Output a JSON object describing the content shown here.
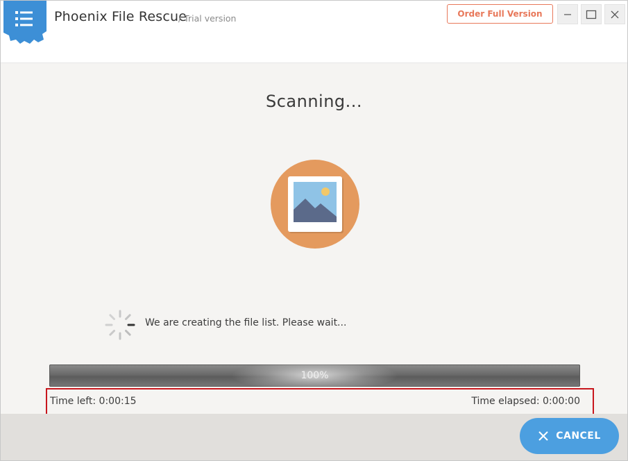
{
  "app": {
    "title": "Phoenix File Rescue",
    "subtitle": "/ Trial version",
    "order_button_label": "Order Full Version"
  },
  "window_controls": {
    "minimize_icon": "minimize-icon",
    "maximize_icon": "maximize-icon",
    "close_icon": "close-icon"
  },
  "main": {
    "heading": "Scanning...",
    "status_text": "We are creating the file list. Please wait...",
    "progress": {
      "value_percent": 100,
      "label": "100%"
    },
    "time_left": "Time left: 0:00:15",
    "time_elapsed": "Time elapsed: 0:00:00"
  },
  "footer": {
    "cancel_label": "CANCEL"
  },
  "colors": {
    "accent_orange": "#e8785a",
    "brand_blue": "#3d8fd6",
    "cancel_blue": "#4c9fe0",
    "icon_circle": "#e49a5e",
    "highlight_red": "#c8161d"
  }
}
